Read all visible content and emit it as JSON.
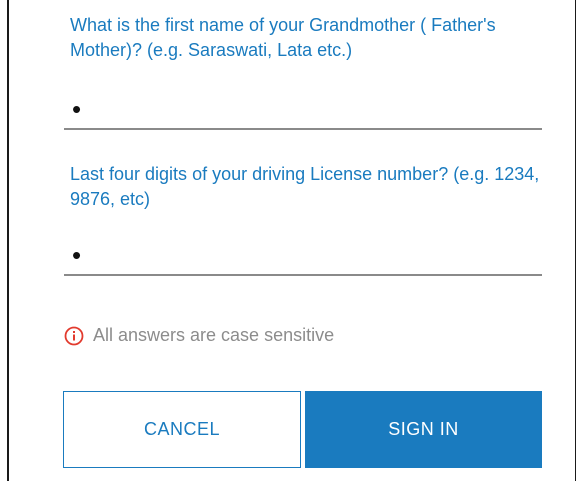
{
  "questions": [
    {
      "label": "What is the first name of your Grandmother ( Father's Mother)? (e.g. Saraswati, Lata etc.)",
      "value": "•"
    },
    {
      "label": "Last four digits of your driving License number? (e.g.  1234, 9876, etc)",
      "value": "•"
    }
  ],
  "hint": {
    "icon": "info-circle-icon",
    "text": "All answers are case sensitive",
    "icon_color": "#e23b2e"
  },
  "buttons": {
    "cancel_label": "CANCEL",
    "signin_label": "SIGN IN"
  },
  "colors": {
    "accent": "#1a7bbf",
    "hint_text": "#8c8c8c"
  }
}
